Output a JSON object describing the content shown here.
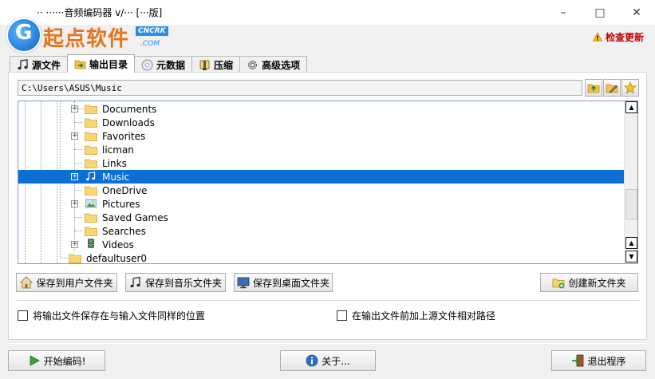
{
  "window": {
    "title": "··  ······音频编码器 v/··· [···版]",
    "minimize_icon": "minimize-icon",
    "maximize_icon": "maximize-icon",
    "close_icon": "close-icon"
  },
  "logo": {
    "text": "起点软件",
    "badge": "CNCRK",
    "domain": ".COM"
  },
  "header": {
    "update_label": "检查更新",
    "update_color": "#c00000"
  },
  "tabs": [
    {
      "label": "源文件",
      "icon": "music-note-icon",
      "active": false
    },
    {
      "label": "输出目录",
      "icon": "folder-arrow-icon",
      "active": true
    },
    {
      "label": "元数据",
      "icon": "cd-icon",
      "active": false
    },
    {
      "label": "压缩",
      "icon": "compress-icon",
      "active": false
    },
    {
      "label": "高级选项",
      "icon": "gear-icon",
      "active": false
    }
  ],
  "output": {
    "path": "C:\\Users\\ASUS\\Music",
    "tool_icons": [
      "folder-up-icon",
      "edit-folder-icon",
      "favorite-star-icon"
    ]
  },
  "tree": {
    "items": [
      {
        "label": "Documents",
        "expandable": true,
        "icon": "folder-icon",
        "selected": false
      },
      {
        "label": "Downloads",
        "expandable": false,
        "icon": "folder-icon",
        "selected": false
      },
      {
        "label": "Favorites",
        "expandable": true,
        "icon": "folder-icon",
        "selected": false
      },
      {
        "label": "licman",
        "expandable": false,
        "icon": "folder-icon",
        "selected": false
      },
      {
        "label": "Links",
        "expandable": false,
        "icon": "folder-icon",
        "selected": false
      },
      {
        "label": "Music",
        "expandable": true,
        "icon": "music-folder-icon",
        "selected": true
      },
      {
        "label": "OneDrive",
        "expandable": false,
        "icon": "folder-icon",
        "selected": false
      },
      {
        "label": "Pictures",
        "expandable": true,
        "icon": "pictures-folder-icon",
        "selected": false
      },
      {
        "label": "Saved Games",
        "expandable": false,
        "icon": "folder-icon",
        "selected": false
      },
      {
        "label": "Searches",
        "expandable": false,
        "icon": "folder-icon",
        "selected": false
      },
      {
        "label": "Videos",
        "expandable": true,
        "icon": "videos-folder-icon",
        "selected": false
      }
    ],
    "parent_sibling": "defaultuser0",
    "selection_color": "#0b6fd3"
  },
  "buttons": {
    "save_user": "保存到用户文件夹",
    "save_music": "保存到音乐文件夹",
    "save_desktop": "保存到桌面文件夹",
    "new_folder": "创建新文件夹"
  },
  "options": {
    "same_location": "将输出文件保存在与输入文件同样的位置",
    "same_location_checked": false,
    "relative_path": "在输出文件前加上源文件相对路径",
    "relative_path_checked": false
  },
  "footer": {
    "start": "开始编码!",
    "about": "关于...",
    "exit": "退出程序"
  }
}
